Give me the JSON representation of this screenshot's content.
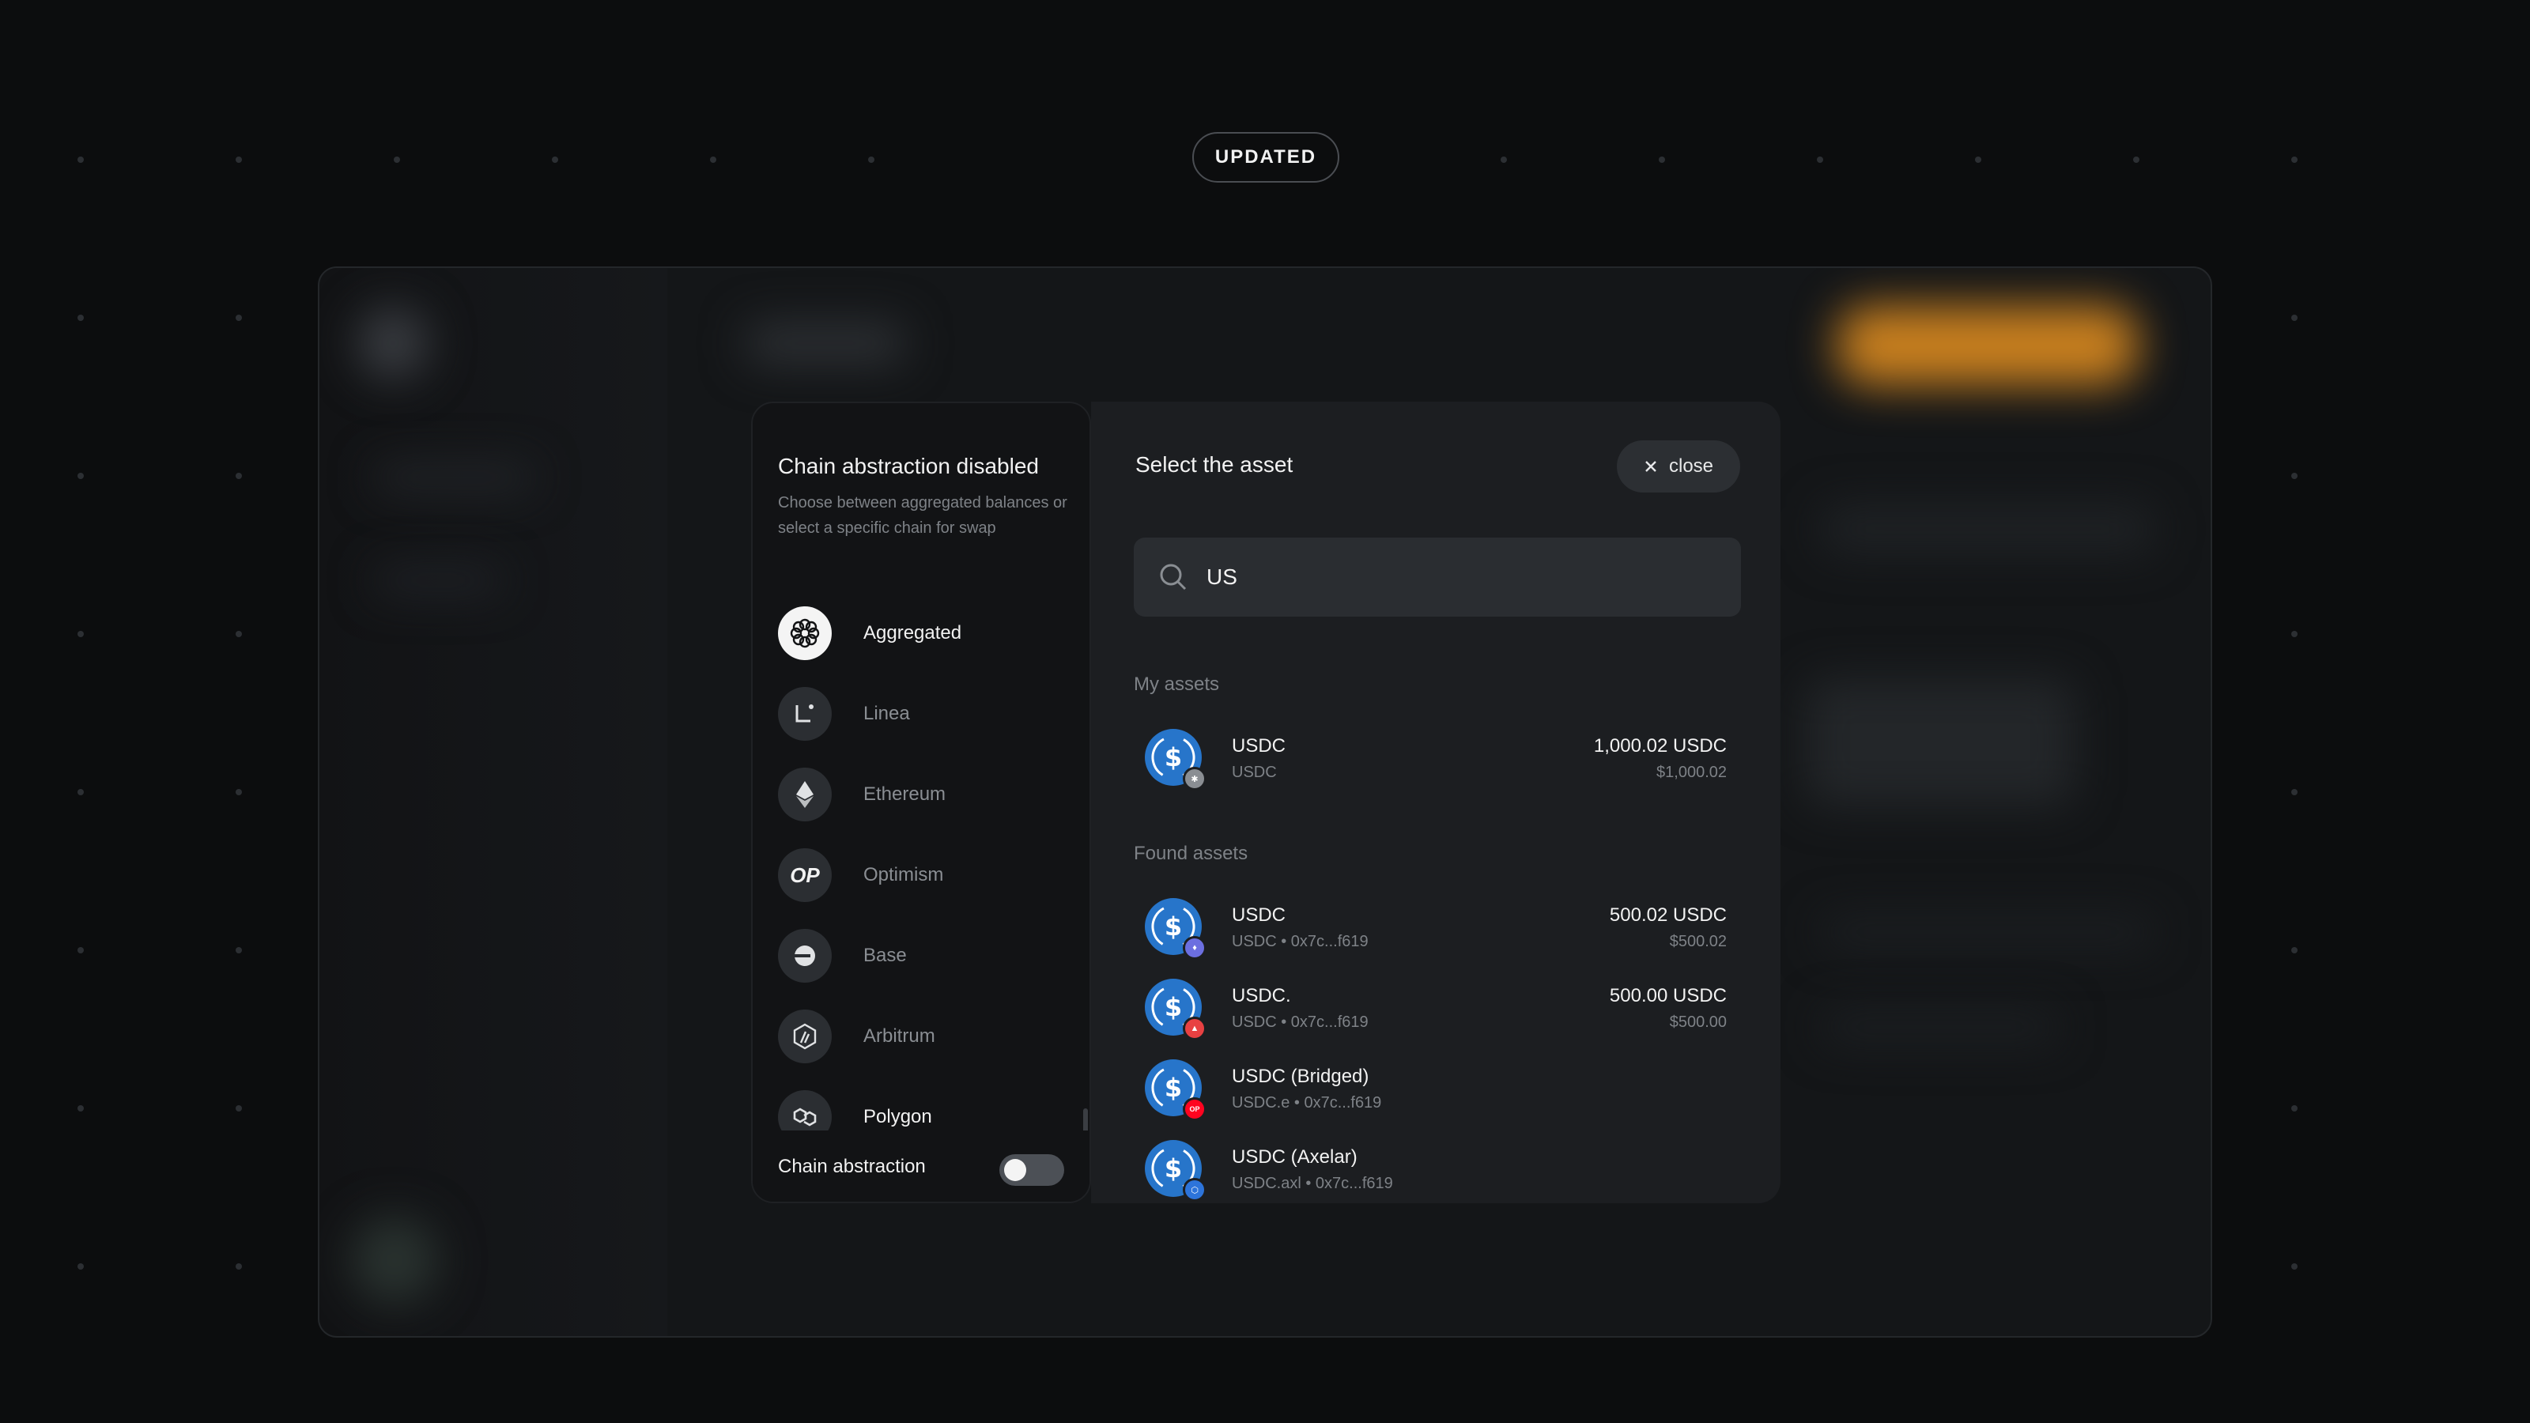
{
  "badge": {
    "label": "UPDATED"
  },
  "chain_panel": {
    "title": "Chain abstraction disabled",
    "description": "Choose between aggregated balances or select a specific chain for swap",
    "chains": [
      {
        "label": "Aggregated",
        "icon": "aggregated-icon",
        "active": true
      },
      {
        "label": "Linea",
        "icon": "linea-icon",
        "active": false
      },
      {
        "label": "Ethereum",
        "icon": "ethereum-icon",
        "active": false
      },
      {
        "label": "Optimism",
        "icon": "optimism-icon",
        "glyph": "OP",
        "active": false
      },
      {
        "label": "Base",
        "icon": "base-icon",
        "active": false
      },
      {
        "label": "Arbitrum",
        "icon": "arbitrum-icon",
        "active": false
      },
      {
        "label": "Polygon",
        "icon": "polygon-icon",
        "active": false
      }
    ],
    "toggle": {
      "label": "Chain abstraction",
      "enabled": false
    }
  },
  "asset_panel": {
    "title": "Select the asset",
    "close_label": "close",
    "search": {
      "value": "US",
      "placeholder": ""
    },
    "my_assets_label": "My assets",
    "found_assets_label": "Found assets",
    "my_assets": [
      {
        "name": "USDC",
        "sub": "USDC",
        "amount": "1,000.02 USDC",
        "fiat": "$1,000.02",
        "chain_icon": "aggregated-icon",
        "chain_color": "#8a8e93"
      }
    ],
    "found_assets": [
      {
        "name": "USDC",
        "sub": "USDC • 0x7c...f619",
        "amount": "500.02 USDC",
        "fiat": "$500.02",
        "chain_icon": "ethereum-icon",
        "chain_color": "#6c6fe0"
      },
      {
        "name": "USDC.",
        "sub": "USDC • 0x7c...f619",
        "amount": "500.00 USDC",
        "fiat": "$500.00",
        "chain_icon": "avalanche-icon",
        "chain_color": "#e84142"
      },
      {
        "name": "USDC (Bridged)",
        "sub": "USDC.e • 0x7c...f619",
        "amount": "",
        "fiat": "",
        "chain_icon": "optimism-icon",
        "chain_color": "#ff0420"
      },
      {
        "name": "USDC (Axelar)",
        "sub": "USDC.axl • 0x7c...f619",
        "amount": "",
        "fiat": "",
        "chain_icon": "arbitrum-icon",
        "chain_color": "#2d74da"
      }
    ]
  },
  "colors": {
    "usdc_blue": "#2775ca",
    "accent_orange": "#c9801f",
    "background": "#0c0d0e"
  }
}
